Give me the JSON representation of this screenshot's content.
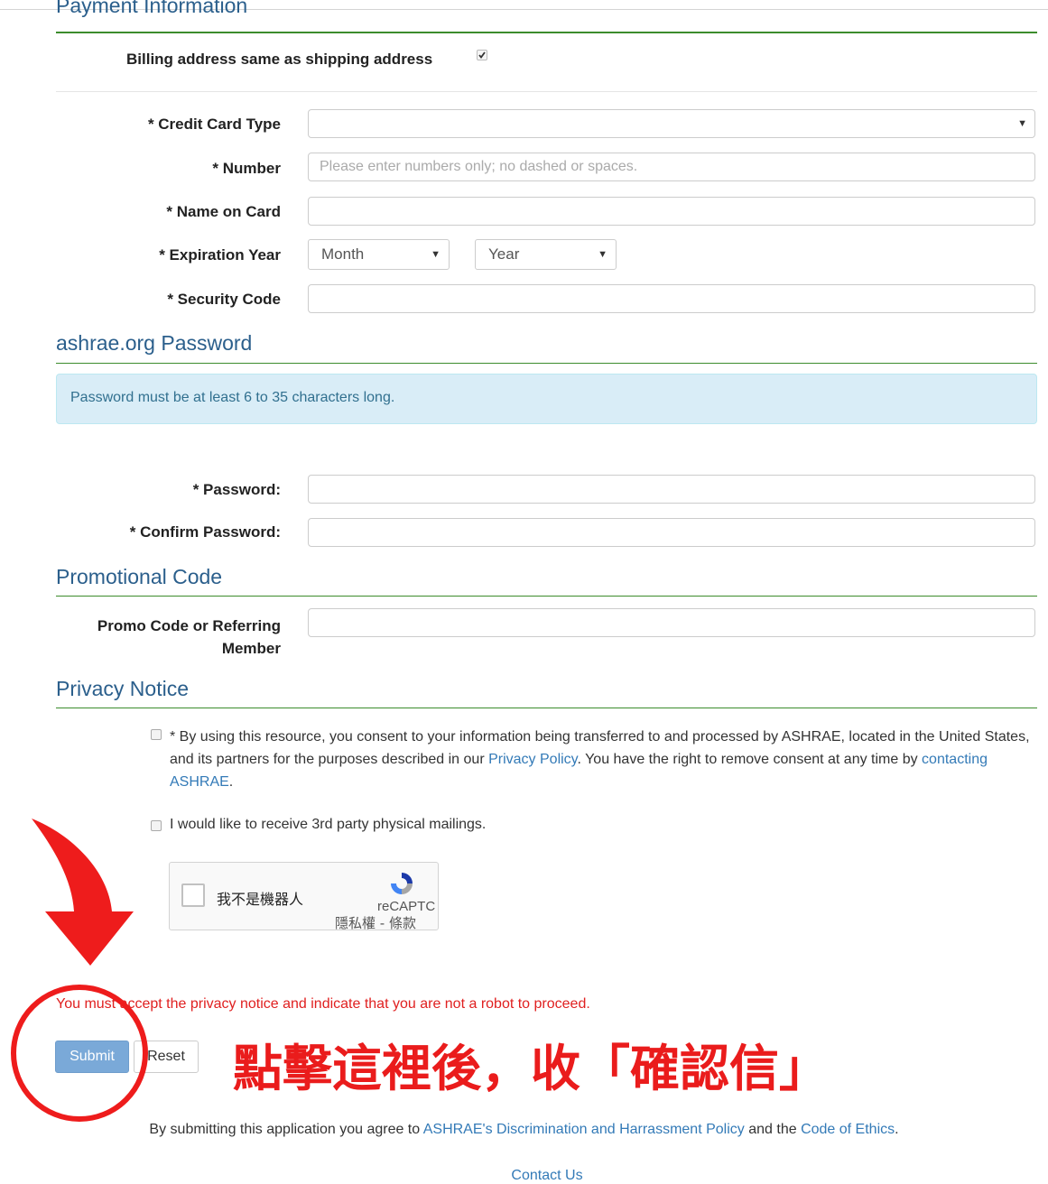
{
  "sections": {
    "payment": "Payment Information",
    "password": "ashrae.org Password",
    "promo": "Promotional Code",
    "privacy": "Privacy Notice"
  },
  "payment": {
    "billing_label": "Billing address same as shipping address",
    "billing_checked": true,
    "card_type_label": "* Credit Card Type",
    "card_type_value": "",
    "number_label": "* Number",
    "number_placeholder": "Please enter numbers only; no dashed or spaces.",
    "name_label": "* Name on Card",
    "exp_label": "* Expiration Year",
    "exp_month": "Month",
    "exp_year": "Year",
    "security_label": "* Security Code"
  },
  "password": {
    "notice": "Password must be at least 6 to 35 characters long.",
    "password_label": "* Password:",
    "confirm_label": "* Confirm Password:"
  },
  "promo": {
    "label_line1": "Promo Code or Referring",
    "label_line2": "Member"
  },
  "privacy": {
    "consent_before": "* By using this resource, you consent to your information being transferred to and processed by ASHRAE, located in the United States, and its partners for the purposes described in our ",
    "privacy_policy_link": "Privacy Policy",
    "consent_middle": ". You have the right to remove consent at any time by ",
    "contacting_link": "contacting ASHRAE",
    "consent_end": ".",
    "mailings_label": "I would like to receive 3rd party physical mailings."
  },
  "recaptcha": {
    "label": "我不是機器人",
    "brand": "reCAPTC",
    "terms": "隱私權 - 條款"
  },
  "error_message": "You must accept the privacy notice and indicate that you are not a robot to proceed.",
  "buttons": {
    "submit": "Submit",
    "reset": "Reset"
  },
  "annotation": "點擊這裡後，收「確認信」",
  "footer": {
    "agree_before": "By submitting this application you agree to ",
    "policy_link": "ASHRAE's Discrimination and Harrassment Policy",
    "agree_middle": " and the ",
    "ethics_link": "Code of Ethics",
    "agree_end": ".",
    "contact": "Contact Us"
  },
  "colors": {
    "section_rule": "#3c8c2c",
    "section_title": "#2b5f8c",
    "link": "#337ab7",
    "error": "#e02020",
    "annotation": "#ea1c1c",
    "submit_bg": "#7aa9d8"
  }
}
